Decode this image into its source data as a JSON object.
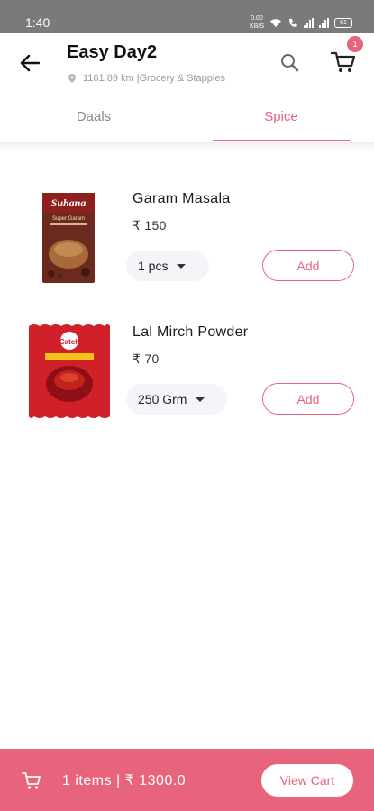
{
  "status_bar": {
    "time": "1:40",
    "net_speed": "0.00\nKB/S",
    "battery": "61"
  },
  "header": {
    "store_name": "Easy Day2",
    "distance": "1161.89 km",
    "category": "|Grocery & Stapples",
    "cart_badge": "1"
  },
  "tabs": [
    {
      "label": "Daals",
      "selected": false
    },
    {
      "label": "Spice",
      "selected": true
    }
  ],
  "products": [
    {
      "name": "Garam Masala",
      "price": "₹ 150",
      "quantity": "1 pcs",
      "add_label": "Add",
      "image_text": "Suhana",
      "image_subtext": "Super Garam"
    },
    {
      "name": "Lal Mirch Powder",
      "price": "₹ 70",
      "quantity": "250 Grm",
      "add_label": "Add",
      "image_text": "Catch"
    }
  ],
  "footer": {
    "summary": "1 items | ₹ 1300.0",
    "view_cart_label": "View Cart"
  },
  "colors": {
    "accent": "#e8647c",
    "status_bar": "#7a7a7a"
  }
}
